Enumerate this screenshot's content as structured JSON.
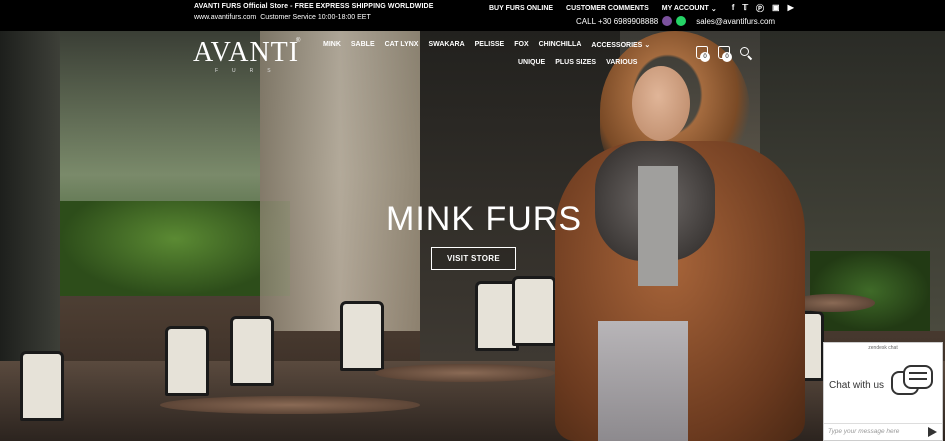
{
  "topbar": {
    "promo": "AVANTI FURS Official Store - FREE EXPRESS SHIPPING WORLDWIDE",
    "site": "www.avantifurs.com",
    "service": "Customer Service 10:00-18:00 EET",
    "links": [
      "BUY FURS ONLINE",
      "CUSTOMER COMMENTS"
    ],
    "account": "MY ACCOUNT",
    "social_icons": [
      "facebook-icon",
      "twitter-icon",
      "pinterest-icon",
      "instagram-icon",
      "youtube-icon"
    ],
    "phone": "CALL +30 6989908888",
    "email": "sales@avantifurs.com"
  },
  "logo": {
    "text": "AVANTI",
    "sub": "FURS"
  },
  "nav": {
    "row1": [
      "MINK",
      "SABLE",
      "CAT LYNX",
      "SWAKARA",
      "PELISSE",
      "FOX",
      "CHINCHILLA"
    ],
    "accessories": "ACCESSORIES",
    "row2": [
      "UNIQUE",
      "PLUS SIZES",
      "VARIOUS"
    ],
    "wishlist_count": "0",
    "cart_count": "0"
  },
  "hero": {
    "headline": "MINK FURS",
    "cta": "VISIT STORE"
  },
  "chat": {
    "brand": "zendesk chat",
    "label": "Chat with us",
    "placeholder": "Type your message here"
  }
}
